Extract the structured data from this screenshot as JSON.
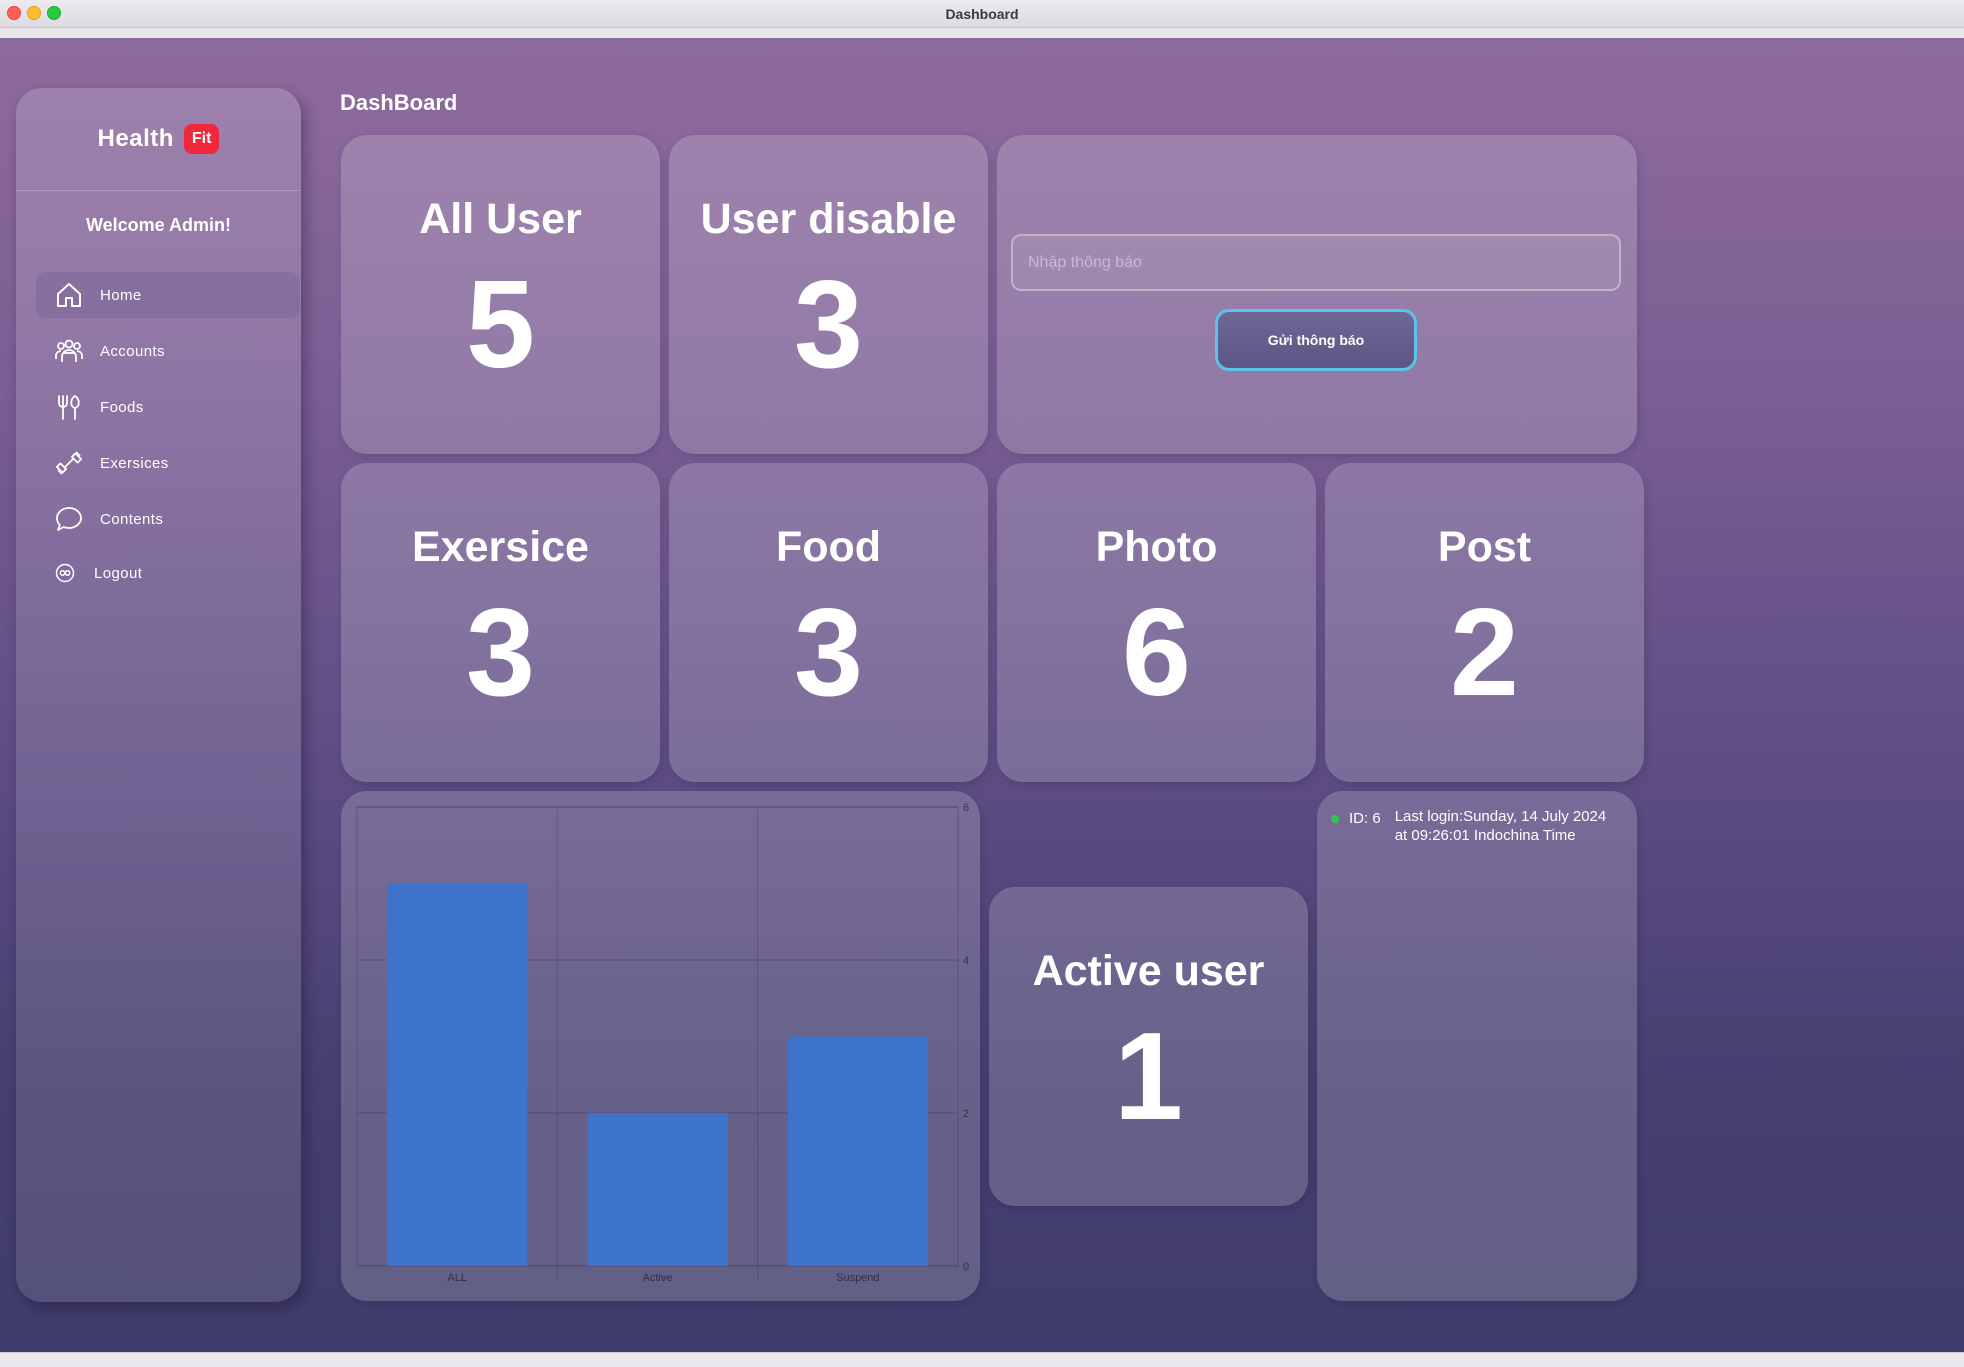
{
  "window": {
    "title": "Dashboard"
  },
  "sidebar": {
    "brand_name": "Health",
    "brand_badge": "Fit",
    "welcome": "Welcome Admin!",
    "items": [
      {
        "label": "Home",
        "icon": "home-icon"
      },
      {
        "label": "Accounts",
        "icon": "users-icon"
      },
      {
        "label": "Foods",
        "icon": "utensils-icon"
      },
      {
        "label": "Exersices",
        "icon": "dumbbell-icon"
      },
      {
        "label": "Contents",
        "icon": "chat-bubble-icon"
      },
      {
        "label": "Logout",
        "icon": "logout-icon"
      }
    ],
    "active_item": "Home"
  },
  "main": {
    "title": "DashBoard",
    "stats": {
      "all_user": {
        "label": "All User",
        "value": "5"
      },
      "user_disable": {
        "label": "User disable",
        "value": "3"
      },
      "exersice": {
        "label": "Exersice",
        "value": "3"
      },
      "food": {
        "label": "Food",
        "value": "3"
      },
      "photo": {
        "label": "Photo",
        "value": "6"
      },
      "post": {
        "label": "Post",
        "value": "2"
      },
      "active_user": {
        "label": "Active user",
        "value": "1"
      }
    },
    "notification": {
      "placeholder": "Nhập thông báo",
      "value": "",
      "send_label": "Gửi thông báo",
      "send_border_color": "#5dc3ea"
    },
    "last_login": {
      "id": "ID: 6",
      "line1": "Last login:Sunday, 14 July 2024",
      "line2": "at 09:26:01 Indochina Time",
      "status_color": "#2ec84a"
    }
  },
  "chart_data": {
    "type": "bar",
    "categories": [
      "ALL",
      "Active",
      "Suspend"
    ],
    "values": [
      5,
      2,
      3
    ],
    "y_ticks": [
      "0",
      "2",
      "4",
      "6"
    ],
    "ylim": [
      0,
      6
    ],
    "bar_color": "#3d74c9",
    "grid": true,
    "y_axis_side": "right"
  }
}
